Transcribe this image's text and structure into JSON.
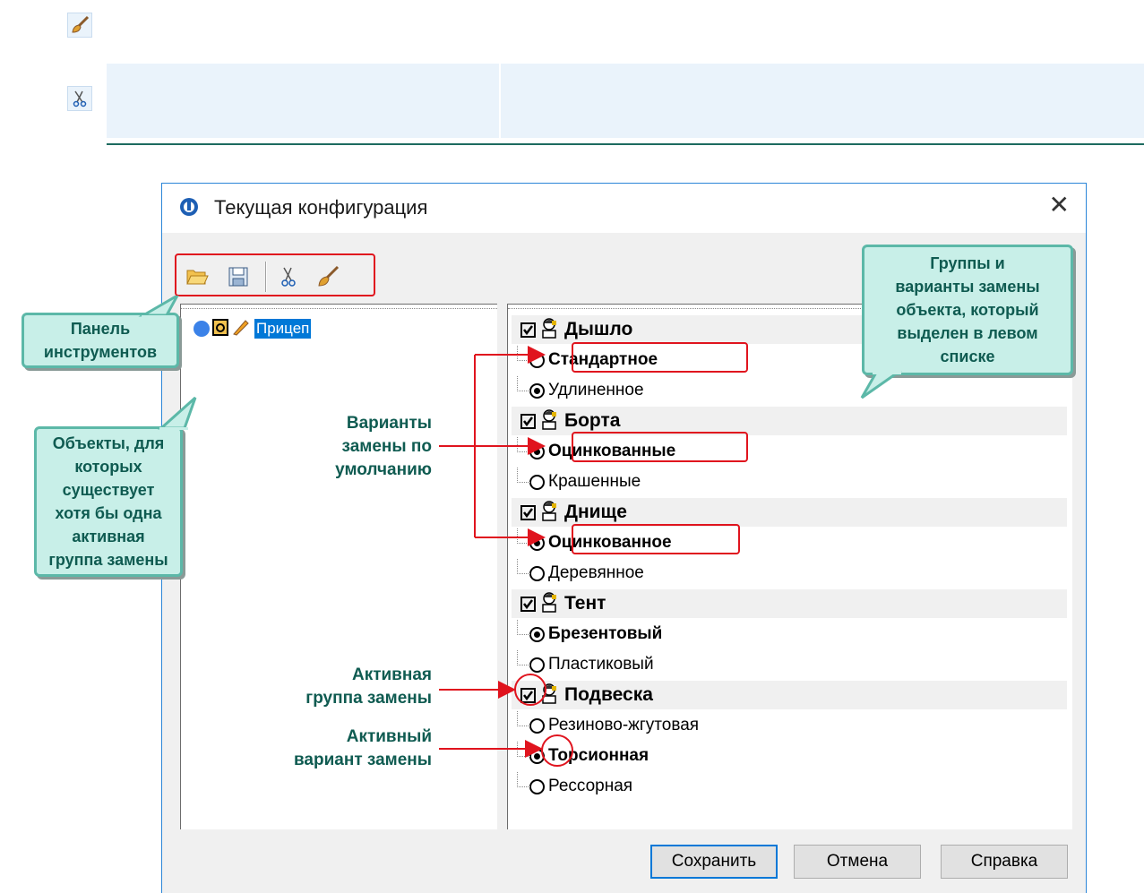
{
  "dialog": {
    "title": "Текущая конфигурация",
    "close_glyph": "✕"
  },
  "toolbar": {
    "icons": [
      "open-folder-icon",
      "save-icon",
      "scissors-icon",
      "brush-icon"
    ]
  },
  "tree": {
    "root_label": "Прицеп"
  },
  "groups": [
    {
      "label": "Дышло",
      "checked": true,
      "options": [
        {
          "label": "Стандартное",
          "selected": false,
          "bold": true
        },
        {
          "label": "Удлиненное",
          "selected": true,
          "bold": false
        }
      ]
    },
    {
      "label": "Борта",
      "checked": true,
      "options": [
        {
          "label": "Оцинкованные",
          "selected": true,
          "bold": true
        },
        {
          "label": "Крашенные",
          "selected": false,
          "bold": false
        }
      ]
    },
    {
      "label": "Днище",
      "checked": true,
      "options": [
        {
          "label": "Оцинкованное",
          "selected": true,
          "bold": true
        },
        {
          "label": "Деревянное",
          "selected": false,
          "bold": false
        }
      ]
    },
    {
      "label": "Тент",
      "checked": true,
      "options": [
        {
          "label": "Брезентовый",
          "selected": true,
          "bold": true
        },
        {
          "label": "Пластиковый",
          "selected": false,
          "bold": false
        }
      ]
    },
    {
      "label": "Подвеска",
      "checked": true,
      "options": [
        {
          "label": "Резиново-жгутовая",
          "selected": false,
          "bold": false
        },
        {
          "label": "Торсионная",
          "selected": true,
          "bold": true
        },
        {
          "label": "Рессорная",
          "selected": false,
          "bold": false
        }
      ]
    }
  ],
  "buttons": {
    "save": "Сохранить",
    "cancel": "Отмена",
    "help": "Справка"
  },
  "callouts": {
    "toolbar_panel": [
      "Панель",
      "инструментов"
    ],
    "groups_info": [
      "Группы и",
      "варианты замены",
      "объекта, который",
      "выделен в левом",
      "списке"
    ],
    "objects_info": [
      "Объекты, для",
      "которых",
      "существует",
      "хотя бы одна",
      "активная",
      "группа замены"
    ]
  },
  "annotations": {
    "default_variants": [
      "Варианты",
      "замены по",
      "умолчанию"
    ],
    "active_group": [
      "Активная",
      "группа замены"
    ],
    "active_variant": [
      "Активный",
      "вариант замены"
    ]
  },
  "colors": {
    "callout_bg": "#c8efe8",
    "callout_text": "#0f5b51",
    "highlight_red": "#e0141e",
    "selection_blue": "#0078d7"
  }
}
